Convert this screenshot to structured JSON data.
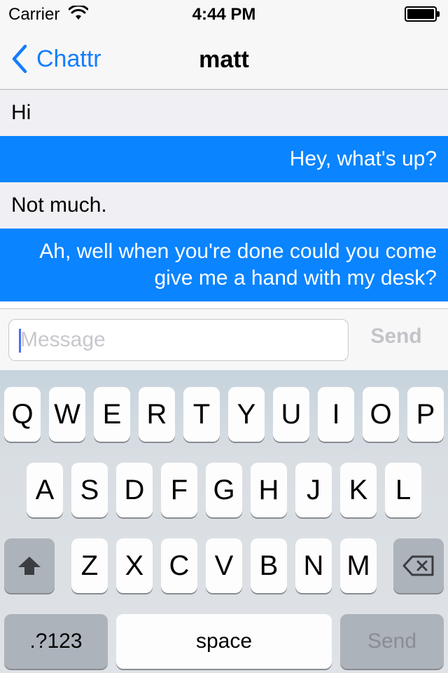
{
  "status_bar": {
    "carrier": "Carrier",
    "time": "4:44 PM",
    "wifi_icon": "wifi-icon",
    "battery_icon": "battery-icon",
    "battery_level": 1.0
  },
  "nav": {
    "back_label": "Chattr",
    "back_icon": "chevron-left-icon",
    "title": "matt",
    "accent_color": "#147efb"
  },
  "messages": [
    {
      "direction": "incoming",
      "text": "Hi"
    },
    {
      "direction": "outgoing",
      "text": "Hey, what's up?"
    },
    {
      "direction": "incoming",
      "text": "Not much."
    },
    {
      "direction": "outgoing",
      "text": "Ah, well when you're done could you come give me a hand with my desk?"
    }
  ],
  "composer": {
    "placeholder": "Message",
    "value": "",
    "send_label": "Send"
  },
  "keyboard": {
    "row1": [
      "Q",
      "W",
      "E",
      "R",
      "T",
      "Y",
      "U",
      "I",
      "O",
      "P"
    ],
    "row2": [
      "A",
      "S",
      "D",
      "F",
      "G",
      "H",
      "J",
      "K",
      "L"
    ],
    "row3": [
      "Z",
      "X",
      "C",
      "V",
      "B",
      "N",
      "M"
    ],
    "shift_icon": "shift-icon",
    "delete_icon": "backspace-icon",
    "numbers_label": ".?123",
    "space_label": "space",
    "return_label": "Send"
  },
  "colors": {
    "outgoing_bubble": "#0a84ff",
    "incoming_bubble": "#efeff4"
  }
}
